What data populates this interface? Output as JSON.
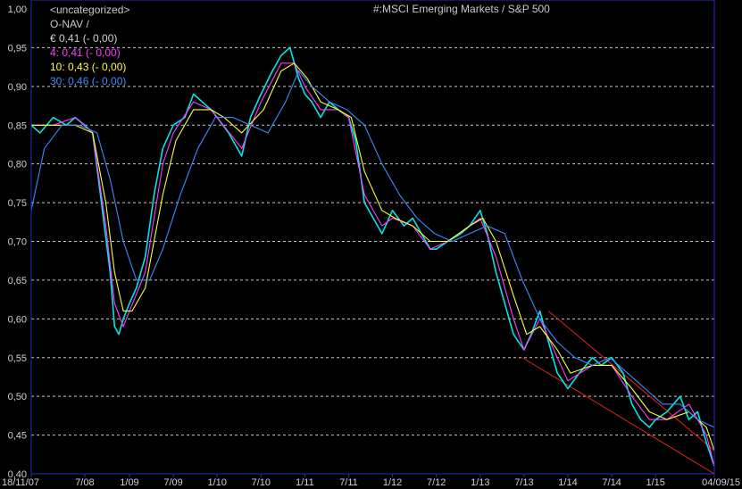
{
  "legend": {
    "category": "<uncategorized>",
    "navline": "O-NAV /",
    "items": [
      {
        "text": "€ 0,41 (- 0,00)",
        "color": "#d0d0d0"
      },
      {
        "text": "4: 0,41 (- 0,00)",
        "color": "#ff3cff"
      },
      {
        "text": "10: 0,43 (- 0,00)",
        "color": "#ffff33"
      },
      {
        "text": "30: 0,46 (- 0,00)",
        "color": "#3c8cff"
      }
    ]
  },
  "chart_data": {
    "type": "line",
    "title": "#:MSCI Emerging Markets / S&P 500",
    "xlabel": "",
    "ylabel": "",
    "ylim": [
      0.4,
      1.0
    ],
    "y_ticks": [
      "1,00",
      "0,95",
      "0,90",
      "0,85",
      "0,80",
      "0,75",
      "0,70",
      "0,65",
      "0,60",
      "0,55",
      "0,50",
      "0,45",
      "0,40"
    ],
    "x_tick_labels": [
      "18/11/07",
      "7/08",
      "1/09",
      "7/09",
      "1/10",
      "7/10",
      "1/11",
      "7/11",
      "1/12",
      "7/12",
      "1/13",
      "7/13",
      "1/14",
      "7/14",
      "1/15",
      "04/09/15"
    ],
    "x_tick_positions": [
      0,
      0.61,
      1.12,
      1.62,
      2.12,
      2.62,
      3.12,
      3.62,
      4.12,
      4.62,
      5.12,
      5.62,
      6.12,
      6.62,
      7.12,
      7.79
    ],
    "grid": true,
    "series": [
      {
        "name": "€",
        "color": "#00e6e6",
        "x": [
          0,
          0.1,
          0.25,
          0.4,
          0.5,
          0.61,
          0.7,
          0.8,
          0.9,
          0.95,
          1.0,
          1.05,
          1.12,
          1.2,
          1.3,
          1.4,
          1.5,
          1.62,
          1.75,
          1.85,
          1.95,
          2.05,
          2.12,
          2.25,
          2.4,
          2.5,
          2.62,
          2.75,
          2.85,
          2.95,
          3.05,
          3.12,
          3.2,
          3.3,
          3.4,
          3.5,
          3.62,
          3.7,
          3.8,
          3.9,
          4.0,
          4.12,
          4.25,
          4.35,
          4.45,
          4.55,
          4.62,
          4.75,
          4.9,
          5.0,
          5.12,
          5.2,
          5.3,
          5.4,
          5.5,
          5.62,
          5.7,
          5.8,
          5.9,
          6.0,
          6.12,
          6.25,
          6.4,
          6.5,
          6.62,
          6.75,
          6.85,
          6.95,
          7.05,
          7.12,
          7.25,
          7.4,
          7.5,
          7.6,
          7.7,
          7.79
        ],
        "y": [
          0.85,
          0.84,
          0.86,
          0.85,
          0.86,
          0.85,
          0.84,
          0.75,
          0.66,
          0.59,
          0.58,
          0.6,
          0.62,
          0.64,
          0.68,
          0.76,
          0.82,
          0.85,
          0.86,
          0.89,
          0.88,
          0.87,
          0.86,
          0.84,
          0.81,
          0.86,
          0.89,
          0.92,
          0.94,
          0.95,
          0.91,
          0.89,
          0.88,
          0.86,
          0.88,
          0.87,
          0.86,
          0.83,
          0.75,
          0.73,
          0.71,
          0.74,
          0.72,
          0.73,
          0.71,
          0.69,
          0.69,
          0.7,
          0.71,
          0.72,
          0.74,
          0.71,
          0.66,
          0.62,
          0.58,
          0.56,
          0.58,
          0.61,
          0.57,
          0.53,
          0.51,
          0.53,
          0.55,
          0.54,
          0.55,
          0.53,
          0.49,
          0.47,
          0.46,
          0.47,
          0.48,
          0.5,
          0.47,
          0.48,
          0.44,
          0.41
        ]
      },
      {
        "name": "4",
        "color": "#ff3cff",
        "x": [
          0,
          0.25,
          0.5,
          0.7,
          0.85,
          0.95,
          1.05,
          1.12,
          1.3,
          1.5,
          1.62,
          1.85,
          2.05,
          2.12,
          2.4,
          2.62,
          2.85,
          3.0,
          3.12,
          3.3,
          3.5,
          3.62,
          3.8,
          4.0,
          4.12,
          4.35,
          4.55,
          4.75,
          5.0,
          5.12,
          5.3,
          5.5,
          5.62,
          5.8,
          6.0,
          6.12,
          6.4,
          6.62,
          6.85,
          7.05,
          7.25,
          7.5,
          7.7,
          7.79
        ],
        "y": [
          0.85,
          0.85,
          0.86,
          0.84,
          0.72,
          0.62,
          0.59,
          0.61,
          0.66,
          0.8,
          0.84,
          0.88,
          0.87,
          0.86,
          0.82,
          0.88,
          0.93,
          0.93,
          0.9,
          0.87,
          0.87,
          0.86,
          0.76,
          0.72,
          0.73,
          0.72,
          0.69,
          0.7,
          0.72,
          0.73,
          0.68,
          0.6,
          0.56,
          0.6,
          0.55,
          0.52,
          0.54,
          0.54,
          0.5,
          0.47,
          0.47,
          0.49,
          0.45,
          0.41
        ]
      },
      {
        "name": "10",
        "color": "#ffff33",
        "x": [
          0,
          0.25,
          0.5,
          0.7,
          0.85,
          0.95,
          1.05,
          1.15,
          1.3,
          1.5,
          1.65,
          1.85,
          2.05,
          2.2,
          2.4,
          2.65,
          2.85,
          3.0,
          3.15,
          3.3,
          3.5,
          3.65,
          3.8,
          4.0,
          4.15,
          4.35,
          4.55,
          4.75,
          5.0,
          5.15,
          5.3,
          5.5,
          5.65,
          5.8,
          6.0,
          6.15,
          6.4,
          6.62,
          6.85,
          7.05,
          7.25,
          7.5,
          7.7,
          7.79
        ],
        "y": [
          0.85,
          0.85,
          0.85,
          0.84,
          0.75,
          0.66,
          0.61,
          0.61,
          0.64,
          0.76,
          0.83,
          0.87,
          0.87,
          0.86,
          0.84,
          0.87,
          0.92,
          0.93,
          0.91,
          0.88,
          0.87,
          0.86,
          0.79,
          0.74,
          0.73,
          0.72,
          0.7,
          0.7,
          0.72,
          0.73,
          0.7,
          0.63,
          0.58,
          0.59,
          0.56,
          0.53,
          0.54,
          0.54,
          0.51,
          0.48,
          0.47,
          0.48,
          0.46,
          0.43
        ]
      },
      {
        "name": "30",
        "color": "#3c8cff",
        "x": [
          0,
          0.15,
          0.35,
          0.55,
          0.75,
          0.9,
          1.05,
          1.2,
          1.35,
          1.5,
          1.7,
          1.9,
          2.1,
          2.3,
          2.5,
          2.7,
          2.9,
          3.05,
          3.2,
          3.4,
          3.6,
          3.8,
          4.0,
          4.2,
          4.4,
          4.6,
          4.8,
          5.0,
          5.2,
          5.4,
          5.6,
          5.8,
          6.0,
          6.2,
          6.4,
          6.6,
          6.8,
          7.0,
          7.2,
          7.4,
          7.6,
          7.79
        ],
        "y": [
          0.74,
          0.82,
          0.85,
          0.85,
          0.84,
          0.78,
          0.7,
          0.65,
          0.65,
          0.69,
          0.76,
          0.82,
          0.86,
          0.86,
          0.85,
          0.84,
          0.88,
          0.92,
          0.9,
          0.88,
          0.87,
          0.85,
          0.8,
          0.76,
          0.73,
          0.71,
          0.7,
          0.71,
          0.72,
          0.71,
          0.65,
          0.6,
          0.57,
          0.55,
          0.54,
          0.55,
          0.53,
          0.51,
          0.49,
          0.49,
          0.47,
          0.46
        ]
      }
    ],
    "channel": {
      "color": "#e62020",
      "upper": {
        "x": [
          5.9,
          7.79
        ],
        "y": [
          0.61,
          0.43
        ]
      },
      "lower": {
        "x": [
          5.6,
          7.79
        ],
        "y": [
          0.55,
          0.4
        ]
      }
    }
  }
}
